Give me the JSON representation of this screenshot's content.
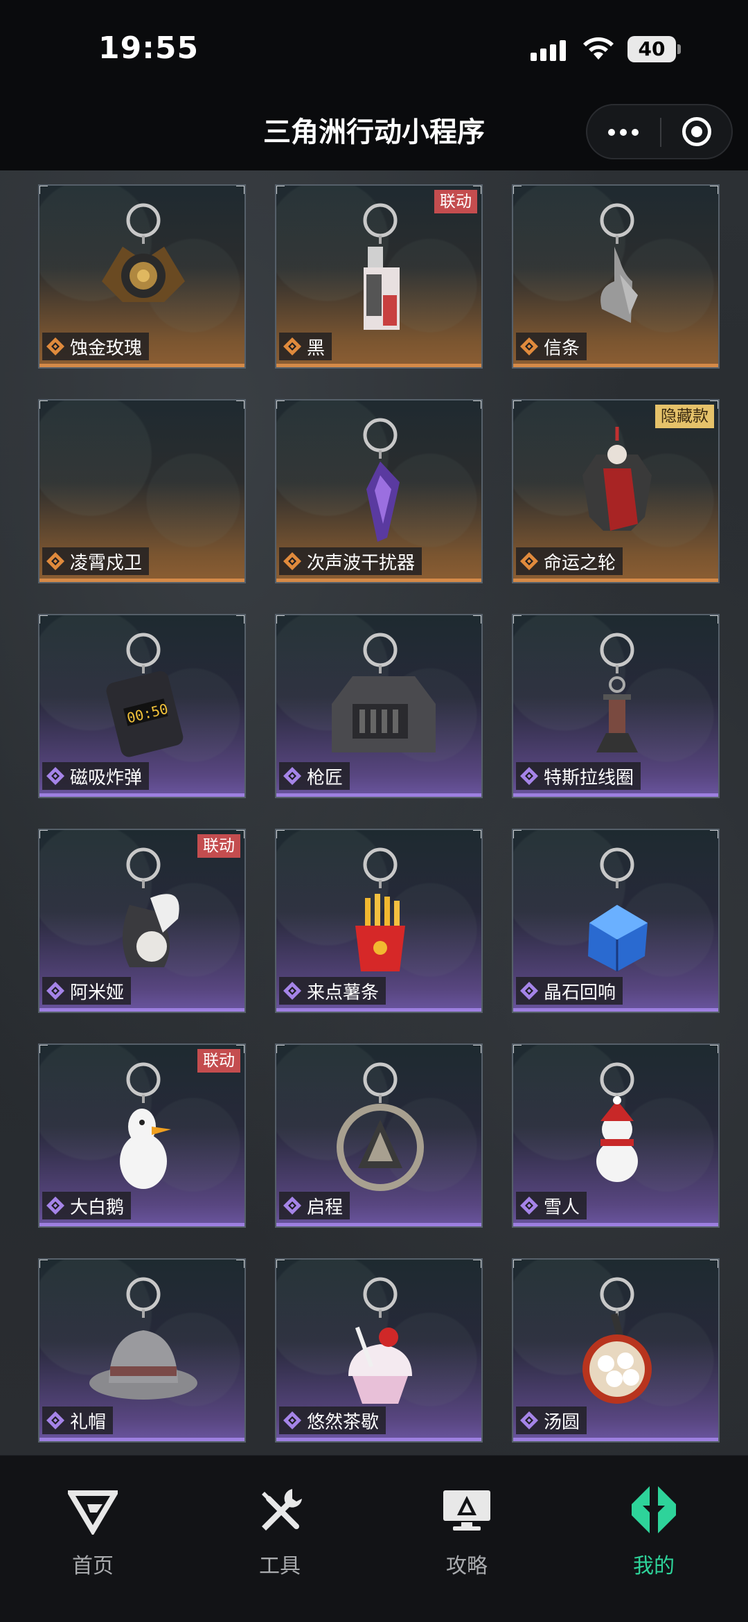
{
  "status_bar": {
    "time": "19:55",
    "battery": "40"
  },
  "header": {
    "title": "三角洲行动小程序"
  },
  "items": [
    {
      "name": "蚀金玫瑰",
      "rarity": "gold",
      "badge": "",
      "icon": "rose-keychain-icon"
    },
    {
      "name": "黑",
      "rarity": "gold",
      "badge": "联动",
      "icon": "card-keychain-icon"
    },
    {
      "name": "信条",
      "rarity": "gold",
      "badge": "",
      "icon": "hood-keychain-icon"
    },
    {
      "name": "凌霄戍卫",
      "rarity": "gold",
      "badge": "",
      "icon": ""
    },
    {
      "name": "次声波干扰器",
      "rarity": "gold",
      "badge": "",
      "icon": "crystal-keychain-icon"
    },
    {
      "name": "命运之轮",
      "rarity": "gold",
      "badge": "隐藏款",
      "icon": "figure-keychain-icon"
    },
    {
      "name": "磁吸炸弹",
      "rarity": "purple",
      "badge": "",
      "icon": "bomb-keychain-icon"
    },
    {
      "name": "枪匠",
      "rarity": "purple",
      "badge": "",
      "icon": "gun-case-keychain-icon"
    },
    {
      "name": "特斯拉线圈",
      "rarity": "purple",
      "badge": "",
      "icon": "tesla-coil-keychain-icon"
    },
    {
      "name": "阿米娅",
      "rarity": "purple",
      "badge": "联动",
      "icon": "bunny-keychain-icon"
    },
    {
      "name": "来点薯条",
      "rarity": "purple",
      "badge": "",
      "icon": "fries-keychain-icon"
    },
    {
      "name": "晶石回响",
      "rarity": "purple",
      "badge": "",
      "icon": "cube-keychain-icon"
    },
    {
      "name": "大白鹅",
      "rarity": "purple",
      "badge": "联动",
      "icon": "goose-keychain-icon"
    },
    {
      "name": "启程",
      "rarity": "purple",
      "badge": "",
      "icon": "medal-keychain-icon"
    },
    {
      "name": "雪人",
      "rarity": "purple",
      "badge": "",
      "icon": "snowman-keychain-icon"
    },
    {
      "name": "礼帽",
      "rarity": "purple",
      "badge": "",
      "icon": "hat-keychain-icon"
    },
    {
      "name": "悠然茶歇",
      "rarity": "purple",
      "badge": "",
      "icon": "cupcake-keychain-icon"
    },
    {
      "name": "汤圆",
      "rarity": "purple",
      "badge": "",
      "icon": "dumpling-bowl-keychain-icon"
    }
  ],
  "nav": [
    {
      "label": "首页",
      "icon": "home-logo-icon",
      "active": false
    },
    {
      "label": "工具",
      "icon": "tools-icon",
      "active": false
    },
    {
      "label": "攻略",
      "icon": "guide-monitor-icon",
      "active": false
    },
    {
      "label": "我的",
      "icon": "profile-logo-icon",
      "active": true
    }
  ],
  "colors": {
    "gold_accent": "#d58a48",
    "purple_accent": "#9d7fe0",
    "collab_badge": "#c44d4f",
    "hidden_badge": "#e5c26a",
    "nav_active": "#2ed39a"
  }
}
